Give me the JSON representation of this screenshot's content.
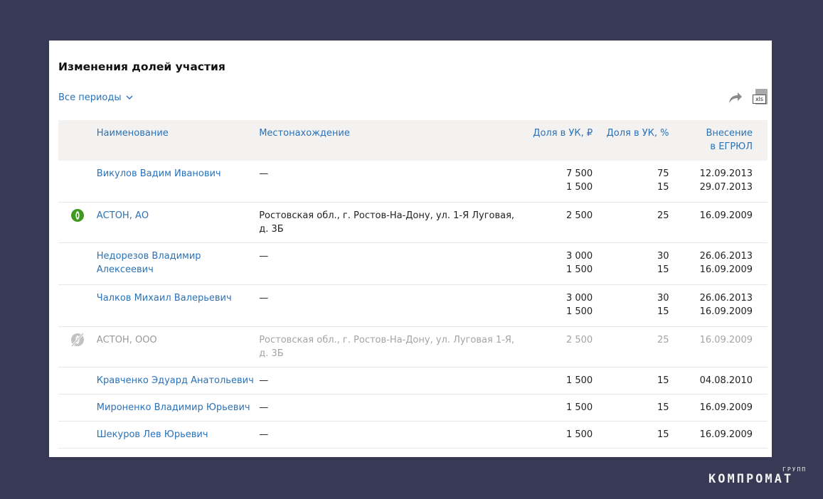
{
  "header": {
    "title": "Изменения долей участия",
    "period_filter": "Все периоды"
  },
  "table": {
    "columns": {
      "name": "Наименование",
      "location": "Местонахождение",
      "share_rub": "Доля в УК, ₽",
      "share_pct": "Доля в УК, %",
      "egrul_line1": "Внесение",
      "egrul_line2": "в ЕГРЮЛ"
    },
    "rows": [
      {
        "name": "Викулов Вадим Иванович",
        "location": "—",
        "status": "",
        "rub": [
          "7 500",
          "1 500"
        ],
        "pct": [
          "75",
          "15"
        ],
        "date": [
          "12.09.2013",
          "29.07.2013"
        ]
      },
      {
        "name": "АСТОН, АО",
        "location": "Ростовская обл., г. Ростов-На-Дону, ул. 1-Я Луговая, д. 3Б",
        "status": "active-company-icon",
        "rub": [
          "2 500"
        ],
        "pct": [
          "25"
        ],
        "date": [
          "16.09.2009"
        ]
      },
      {
        "name": "Недорезов Владимир Алексеевич",
        "location": "—",
        "status": "",
        "rub": [
          "3 000",
          "1 500"
        ],
        "pct": [
          "30",
          "15"
        ],
        "date": [
          "26.06.2013",
          "16.09.2009"
        ]
      },
      {
        "name": "Чалков Михаил Валерьевич",
        "location": "—",
        "status": "",
        "rub": [
          "3 000",
          "1 500"
        ],
        "pct": [
          "30",
          "15"
        ],
        "date": [
          "26.06.2013",
          "16.09.2009"
        ]
      },
      {
        "name": "АСТОН, ООО",
        "location": "Ростовская обл., г. Ростов-На-Дону, ул. Луговая 1-Я, д. 3Б",
        "status": "liquidated-company-icon",
        "rub": [
          "2 500"
        ],
        "pct": [
          "25"
        ],
        "date": [
          "16.09.2009"
        ]
      },
      {
        "name": "Кравченко Эдуард Анатольевич",
        "location": "—",
        "status": "",
        "rub": [
          "1 500"
        ],
        "pct": [
          "15"
        ],
        "date": [
          "04.08.2010"
        ]
      },
      {
        "name": "Мироненко Владимир Юрьевич",
        "location": "—",
        "status": "",
        "rub": [
          "1 500"
        ],
        "pct": [
          "15"
        ],
        "date": [
          "16.09.2009"
        ]
      },
      {
        "name": "Шекуров Лев Юрьевич",
        "location": "—",
        "status": "",
        "rub": [
          "1 500"
        ],
        "pct": [
          "15"
        ],
        "date": [
          "16.09.2009"
        ]
      }
    ]
  },
  "watermark": {
    "main": "КОМПРОМАТ",
    "sup": "ГРУПП"
  },
  "colors": {
    "background": "#383a55",
    "link": "#2a72b8",
    "header_row": "#f3f2f0",
    "active_icon": "#3f9a1f",
    "inactive_text": "#a4a4a4"
  }
}
